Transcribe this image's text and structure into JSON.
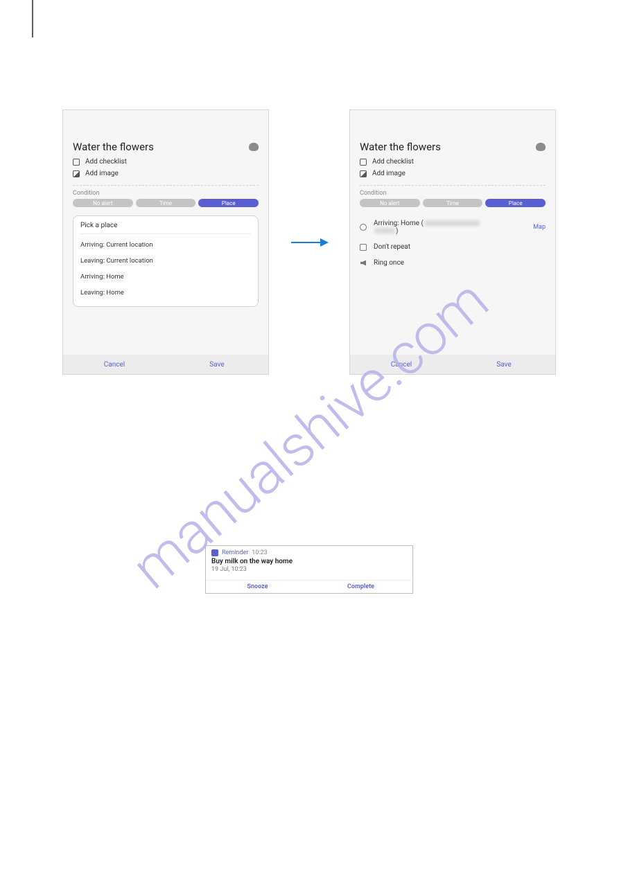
{
  "watermark": "manualshive.com",
  "left": {
    "title": "Water the flowers",
    "add_checklist": "Add checklist",
    "add_image": "Add image",
    "condition_label": "Condition",
    "seg": {
      "noalert": "No alert",
      "time": "Time",
      "place": "Place"
    },
    "dropdown": {
      "header": "Pick a place",
      "items": [
        "Arriving: Current location",
        "Leaving: Current location",
        "Arriving: Home",
        "Leaving: Home"
      ]
    },
    "cancel": "Cancel",
    "save": "Save"
  },
  "right": {
    "title": "Water the flowers",
    "add_checklist": "Add checklist",
    "add_image": "Add image",
    "condition_label": "Condition",
    "seg": {
      "noalert": "No alert",
      "time": "Time",
      "place": "Place"
    },
    "settings": {
      "arriving_prefix": "Arriving: Home (",
      "arriving_suffix": ")",
      "map": "Map",
      "repeat": "Don't repeat",
      "ring": "Ring once"
    },
    "cancel": "Cancel",
    "save": "Save"
  },
  "notif": {
    "app": "Reminder",
    "time": "10:23",
    "title": "Buy milk on the way home",
    "sub": "19 Jul, 10:23",
    "snooze": "Snooze",
    "complete": "Complete"
  }
}
